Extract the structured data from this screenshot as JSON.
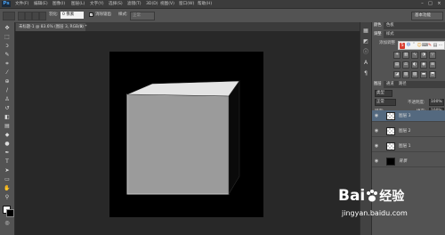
{
  "menubar": {
    "logo": "Ps",
    "items": [
      "文件(F)",
      "编辑(E)",
      "图像(I)",
      "图层(L)",
      "文字(Y)",
      "选择(S)",
      "滤镜(T)",
      "3D(D)",
      "视图(V)",
      "窗口(W)",
      "帮助(H)"
    ],
    "window_controls": [
      "–",
      "□",
      "×"
    ]
  },
  "options": {
    "feather_label": "羽化:",
    "feather_value": "0 像素",
    "antialias_label": "消除锯齿",
    "style_label": "样式:",
    "style_value": "正常",
    "refine_edge": "调整边缘...",
    "workspace": "基本功能"
  },
  "document": {
    "tab_title": "未标题-1 @ 83.6% (图层 3, RGB/8) *",
    "tab_close": "×"
  },
  "panels": {
    "top_tabs": [
      "颜色",
      "色板"
    ],
    "mid_tabs": [
      "调整",
      "样式"
    ],
    "add_adjust": "添加调整",
    "ime_items": [
      "S",
      "中",
      "˘",
      "☺",
      "⌨",
      "✎",
      "▤",
      "⋯"
    ],
    "layer_tabs": [
      "图层",
      "通道",
      "路径"
    ],
    "blend_mode": "正常",
    "opacity_label": "不透明度:",
    "opacity_value": "100%",
    "lock_label": "锁定:",
    "fill_label": "填充:",
    "fill_value": "100%",
    "kind_label": "类型"
  },
  "layers": [
    {
      "name": "图层 3",
      "selected": true
    },
    {
      "name": "图层 2",
      "selected": false
    },
    {
      "name": "图层 1",
      "selected": false
    },
    {
      "name": "背景",
      "selected": false
    }
  ],
  "watermark": {
    "brand": "Bai",
    "brand_tail": "经验",
    "url": "jingyan.baidu.com"
  },
  "colors": {
    "ui_dark": "#282828",
    "panel": "#535353",
    "selected_layer": "#54697f",
    "baidu_red": "#d83a2e",
    "baidu_blue": "#2a63c6"
  }
}
